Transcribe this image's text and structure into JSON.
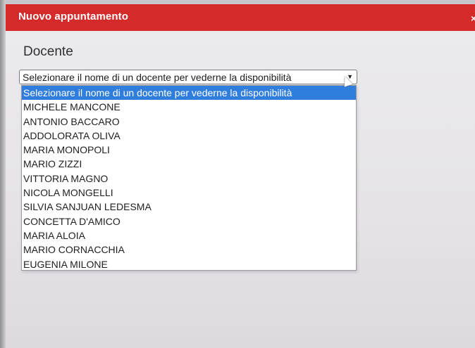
{
  "dialog": {
    "title": "Nuovo appuntamento",
    "close_label": "×"
  },
  "form": {
    "label": "Docente",
    "select_value": "Selezionare il nome di un docente per vederne la disponibilità",
    "arrow": "▼"
  },
  "dropdown": {
    "options": [
      "Selezionare il nome di un docente per vederne la disponibilità",
      "MICHELE MANCONE",
      "ANTONIO BACCARO",
      "ADDOLORATA OLIVA",
      "MARIA MONOPOLI",
      "MARIO ZIZZI",
      "VITTORIA MAGNO",
      "NICOLA MONGELLI",
      "SILVIA SANJUAN LEDESMA",
      "CONCETTA D'AMICO",
      "MARIA ALOIA",
      "MARIO CORNACCHIA",
      "EUGENIA MILONE"
    ],
    "selected_index": 0
  },
  "colors": {
    "titlebar": "#d42a2a",
    "highlight": "#2f7ddd"
  }
}
